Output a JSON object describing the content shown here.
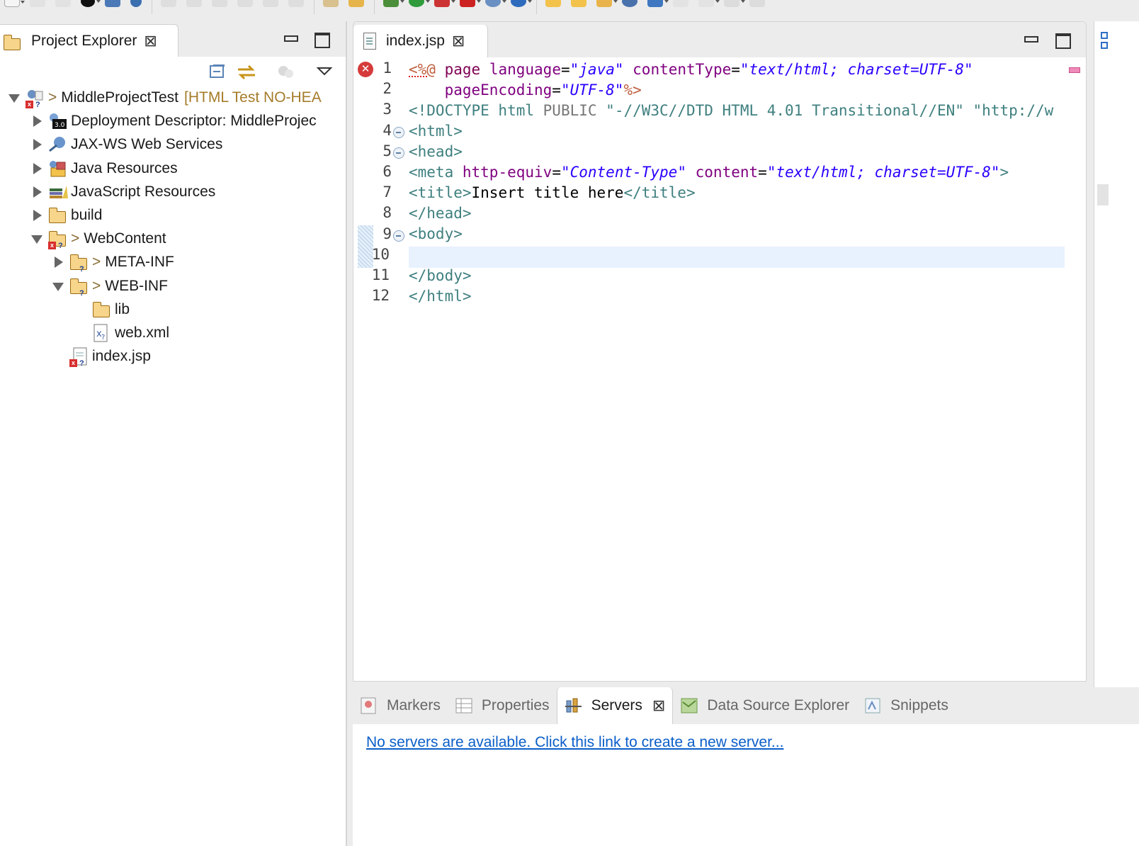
{
  "project_explorer": {
    "title": "Project Explorer",
    "tree": [
      {
        "label": "MiddleProjectTest",
        "decoration": "[HTML Test NO-HEA",
        "prefix": ">",
        "state": "open",
        "depth": 0
      },
      {
        "label": "Deployment Descriptor: MiddleProjec",
        "state": "closed",
        "depth": 1
      },
      {
        "label": "JAX-WS Web Services",
        "state": "closed",
        "depth": 1
      },
      {
        "label": "Java Resources",
        "state": "closed",
        "depth": 1
      },
      {
        "label": "JavaScript Resources",
        "state": "closed",
        "depth": 1
      },
      {
        "label": "build",
        "state": "closed",
        "depth": 1
      },
      {
        "label": "WebContent",
        "prefix": ">",
        "state": "open",
        "depth": 1
      },
      {
        "label": "META-INF",
        "prefix": ">",
        "state": "closed",
        "depth": 2
      },
      {
        "label": "WEB-INF",
        "prefix": ">",
        "state": "open",
        "depth": 2
      },
      {
        "label": "lib",
        "state": "none",
        "depth": 3
      },
      {
        "label": "web.xml",
        "state": "none",
        "depth": 3
      },
      {
        "label": "index.jsp",
        "state": "none",
        "depth": 2
      }
    ]
  },
  "editor": {
    "tab_label": "index.jsp",
    "line_numbers": [
      "1",
      "2",
      "3",
      "4",
      "5",
      "6",
      "7",
      "8",
      "9",
      "10",
      "11",
      "12"
    ]
  },
  "bottom_panel": {
    "tabs": [
      "Markers",
      "Properties",
      "Servers",
      "Data Source Explorer",
      "Snippets"
    ],
    "active_tab": "Servers",
    "servers_message": "No servers are available. Click this link to create a new server..."
  }
}
